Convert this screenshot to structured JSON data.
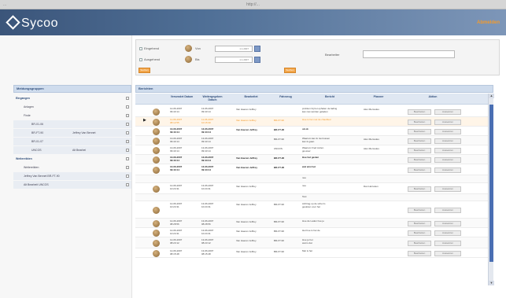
{
  "window": {
    "left_text": "...",
    "url": "http://..."
  },
  "header": {
    "logo": "Sycoo",
    "logout": "Abmelden"
  },
  "filter": {
    "row1": {
      "label": "Eingehend",
      "from_label": "Von",
      "from_value": "1.1.2007"
    },
    "row2": {
      "label": "Ausgehend",
      "to_label": "Bis",
      "to_value": "1.1.2007"
    },
    "bed_label": "Bearbeiter",
    "btn_left": "Suchen",
    "btn_right": "Suchen"
  },
  "left_panel": {
    "title": "Meldungsgruppen",
    "items": [
      {
        "label": "Eingangen",
        "indent": 0,
        "bold": true,
        "alt": false
      },
      {
        "label": "Anlagen",
        "indent": 1,
        "bold": false,
        "alt": false
      },
      {
        "label": "Finde",
        "indent": 1,
        "bold": false,
        "alt": false
      },
      {
        "label": "BR-01-06",
        "indent": 2,
        "bold": false,
        "alt": true,
        "extra": ""
      },
      {
        "label": "BR-FT-90",
        "indent": 2,
        "bold": false,
        "alt": true,
        "extra": "Jeffrey Van Bennet"
      },
      {
        "label": "BR-01-07",
        "indent": 2,
        "bold": false,
        "alt": true,
        "extra": ""
      },
      {
        "label": "UNCOS",
        "indent": 2,
        "bold": false,
        "alt": true,
        "extra": "Alt Bearbei"
      },
      {
        "label": "Weitereikten",
        "indent": 0,
        "bold": true,
        "alt": false
      },
      {
        "label": "Weitereikten",
        "indent": 1,
        "bold": false,
        "alt": false
      },
      {
        "label": "Jeffrey Van Bennet BR-FT-90",
        "indent": 1,
        "bold": false,
        "alt": true
      },
      {
        "label": "Alt Bearbeit UNCOS",
        "indent": 1,
        "bold": false,
        "alt": true
      }
    ]
  },
  "results": {
    "title": "Berichten",
    "headers": [
      "Versendet Datum",
      "Weitergegeben Datum",
      "Bearbeitet",
      "Fahrzeug",
      "Bericht",
      "Plasner",
      "Aktion"
    ],
    "btn_a": "Bearbeiten",
    "btn_b": "Aussetzen",
    "rows": [
      {
        "d1": "12-06-2007",
        "d1b": "09:43:14",
        "d2": "13-06-2007",
        "d2b": "09:43:14",
        "by": "Van Haeren Jeffrey",
        "veh": "",
        "msg": "problem bij het ophalen de lading",
        "msg2": "kan niet worden geladen",
        "pl": "Alex Mercedes",
        "h": 14,
        "style": "",
        "sel": false
      },
      {
        "d1": "11-06-2007",
        "d1b": "08:12:55",
        "d2": "11-06-2007",
        "d2b": "10:15:30",
        "by": "Van Haeren Jeffrey",
        "veh": "BR-FT-90",
        "msg": "Hoe is het met de chauffeur",
        "msg2": "",
        "pl": "",
        "h": 12,
        "style": "o",
        "sel": true
      },
      {
        "d1": "13-06-2007",
        "d1b": "09:43:14",
        "d2": "13-06-2007",
        "d2b": "09:43:14",
        "by": "Van Haeren Jeffrey",
        "veh": "BR-FT-90",
        "msg": "ok ok",
        "msg2": "",
        "pl": "",
        "h": 12,
        "style": "b",
        "sel": false
      },
      {
        "d1": "13-06-2007",
        "d1b": "09:43:14",
        "d2": "13-06-2007",
        "d2b": "09:43:14",
        "by": "",
        "veh": "BR-FT-90",
        "msg": "Waarom kan ik niet lossen",
        "msg2": "kan ik gaan",
        "pl": "Alex Mercedes",
        "h": 12,
        "style": "",
        "sel": false
      },
      {
        "d1": "13-06-2007",
        "d1b": "09:43:14",
        "d2": "13-06-2007",
        "d2b": "09:43:14",
        "by": "",
        "veh": "UNCOS",
        "msg": "Waarom Fred zetten",
        "msg2": "ga weer",
        "pl": "Alex Mercedes",
        "h": 12,
        "style": "",
        "sel": false
      },
      {
        "d1": "13-06-2007",
        "d1b": "09:43:14",
        "d2": "13-06-2007",
        "d2b": "09:43:14",
        "by": "Van Haeren Jeffrey",
        "veh": "BR-FT-90",
        "msg": "Hoe het gezien",
        "msg2": "",
        "pl": "",
        "h": 12,
        "style": "b",
        "sel": false
      },
      {
        "d1": "13-06-2007",
        "d1b": "09:43:14",
        "d2": "13-06-2007",
        "d2b": "09:43:14",
        "by": "Van Haeren Jeffrey",
        "veh": "BR-FT-90",
        "msg": "wat wist het",
        "msg2": "",
        "pl": "",
        "h": 14,
        "style": "b",
        "sel": false
      },
      {
        "d1": "",
        "d1b": "",
        "d2": "",
        "d2b": "",
        "by": "",
        "veh": "",
        "msg": "nee",
        "msg2": "",
        "pl": "",
        "h": 10,
        "style": "",
        "sel": false
      },
      {
        "d1": "12-06-2007",
        "d1b": "10:24:31",
        "d2": "13-06-2007",
        "d2b": "10:24:31",
        "by": "Van Haeren Jeffrey",
        "veh": "",
        "msg": "nee",
        "msg2": "",
        "pl": "Dan Herreken",
        "h": 14,
        "style": "",
        "sel": false
      },
      {
        "d1": "",
        "d1b": "",
        "d2": "",
        "d2b": "",
        "by": "",
        "veh": "",
        "msg": "Test",
        "msg2": "",
        "pl": "",
        "h": 9,
        "style": "",
        "sel": false
      },
      {
        "d1": "12-06-2007",
        "d1b": "10:24:31",
        "d2": "13-06-2007",
        "d2b": "10:24:31",
        "by": "Van Haeren Jeffrey",
        "veh": "BR-FT-90",
        "msg": "Achtrag op de scherm",
        "msg2": "gesloten voor het",
        "pl": "",
        "h": 22,
        "style": "",
        "sel": false
      },
      {
        "d1": "12-06-2007",
        "d1b": "08:28:56",
        "d2": "13-06-2007",
        "d2b": "08:28:56",
        "by": "Van Haeren Jeffrey",
        "veh": "BR-FT-90",
        "msg": "Hoe de Laden hoe je",
        "msg2": "",
        "pl": "",
        "h": 12,
        "style": "",
        "sel": false
      },
      {
        "d1": "12-06-2007",
        "d1b": "10:24:31",
        "d2": "13-06-2007",
        "d2b": "10:24:31",
        "by": "Van Haeren Jeffrey",
        "veh": "BR-FT-90",
        "msg": "Het hoe is het de",
        "msg2": "",
        "pl": "",
        "h": 12,
        "style": "",
        "sel": false
      },
      {
        "d1": "12-06-2007",
        "d1b": "08:23:12",
        "d2": "13-06-2007",
        "d2b": "08:23:12",
        "by": "Van Haeren Jeffrey",
        "veh": "BR-FT-90",
        "msg": "Hoe je het",
        "msg2": "wat is dat",
        "pl": "",
        "h": 14,
        "style": "",
        "sel": false
      },
      {
        "d1": "12-06-2007",
        "d1b": "08:15:48",
        "d2": "13-06-2007",
        "d2b": "08:15:48",
        "by": "Van Haeren Jeffrey",
        "veh": "BR-FT-90",
        "msg": "Met is het",
        "msg2": "",
        "pl": "",
        "h": 12,
        "style": "",
        "sel": false
      }
    ]
  }
}
